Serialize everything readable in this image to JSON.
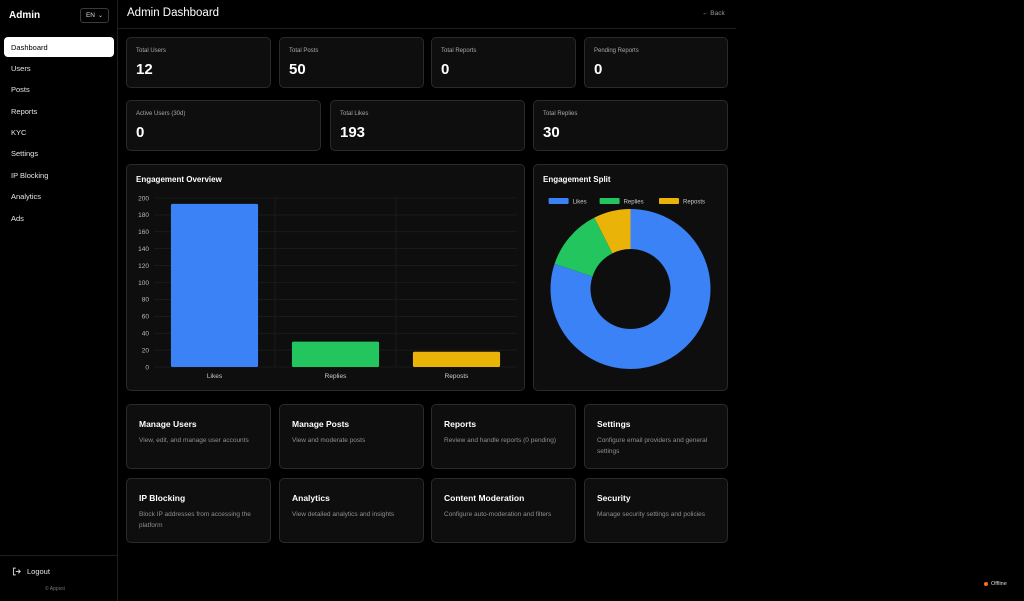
{
  "sidebar": {
    "brand": "Admin",
    "lang": "EN",
    "items": [
      {
        "label": "Dashboard",
        "active": true
      },
      {
        "label": "Users"
      },
      {
        "label": "Posts"
      },
      {
        "label": "Reports"
      },
      {
        "label": "KYC"
      },
      {
        "label": "Settings"
      },
      {
        "label": "IP Blocking"
      },
      {
        "label": "Analytics"
      },
      {
        "label": "Ads"
      }
    ],
    "logout": "Logout",
    "footer": "© Appssi"
  },
  "header": {
    "title": "Admin Dashboard",
    "back": "← Back"
  },
  "stats_row1": [
    {
      "label": "Total Users",
      "value": "12"
    },
    {
      "label": "Total Posts",
      "value": "50"
    },
    {
      "label": "Total Reports",
      "value": "0"
    },
    {
      "label": "Pending Reports",
      "value": "0"
    }
  ],
  "stats_row2": [
    {
      "label": "Active Users (30d)",
      "value": "0"
    },
    {
      "label": "Total Likes",
      "value": "193"
    },
    {
      "label": "Total Replies",
      "value": "30"
    }
  ],
  "engagement_overview": {
    "title": "Engagement Overview",
    "chart_data": {
      "type": "bar",
      "categories": [
        "Likes",
        "Replies",
        "Reposts"
      ],
      "values": [
        193,
        30,
        18
      ],
      "ylim": [
        0,
        200
      ],
      "yticks": [
        0,
        20,
        40,
        60,
        80,
        100,
        120,
        140,
        160,
        180,
        200
      ],
      "colors": [
        "#3b82f6",
        "#22c55e",
        "#eab308"
      ],
      "grid": true
    }
  },
  "engagement_split": {
    "title": "Engagement Split",
    "chart_data": {
      "type": "pie",
      "donut": true,
      "legend_position": "top",
      "labels": [
        "Likes",
        "Replies",
        "Reposts"
      ],
      "values": [
        193,
        30,
        18
      ],
      "colors": [
        "#3b82f6",
        "#22c55e",
        "#eab308"
      ]
    }
  },
  "actions": [
    {
      "title": "Manage Users",
      "desc": "View, edit, and manage user accounts"
    },
    {
      "title": "Manage Posts",
      "desc": "View and moderate posts"
    },
    {
      "title": "Reports",
      "desc": "Review and handle reports (0 pending)"
    },
    {
      "title": "Settings",
      "desc": "Configure email providers and general settings"
    },
    {
      "title": "IP Blocking",
      "desc": "Block IP addresses from accessing the platform"
    },
    {
      "title": "Analytics",
      "desc": "View detailed analytics and insights"
    },
    {
      "title": "Content Moderation",
      "desc": "Configure auto-moderation and filters"
    },
    {
      "title": "Security",
      "desc": "Manage security settings and policies"
    }
  ],
  "status": {
    "label": "Offline",
    "color": "#f97316"
  }
}
